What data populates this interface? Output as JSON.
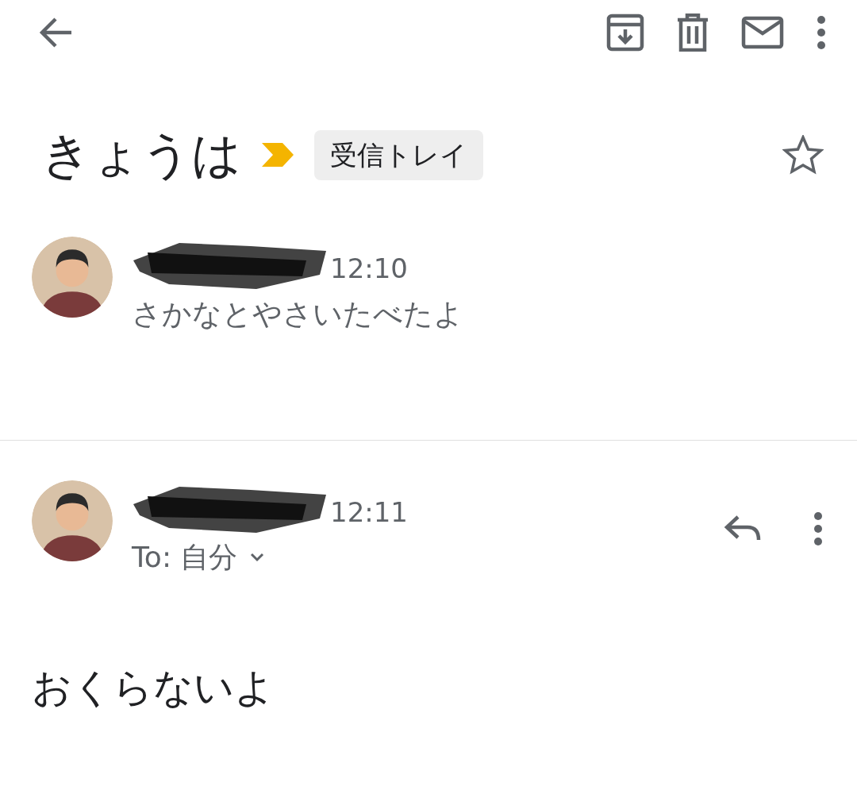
{
  "subject": "きょうは",
  "important": true,
  "label": {
    "text": "受信トレイ"
  },
  "starred": false,
  "messages": [
    {
      "time": "12:10",
      "expanded": false,
      "snippet": "さかなとやさいたべたよ"
    },
    {
      "time": "12:11",
      "expanded": true,
      "recipient": "To: 自分",
      "body": "おくらないよ"
    }
  ]
}
